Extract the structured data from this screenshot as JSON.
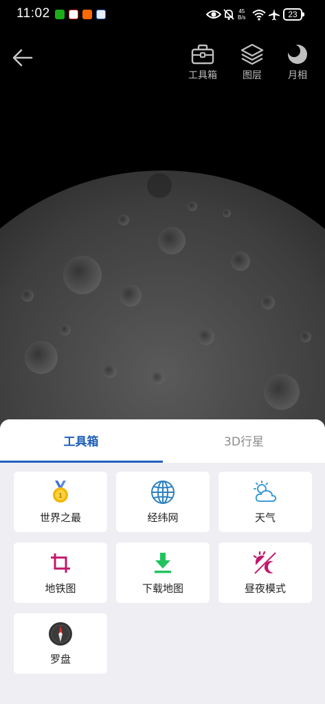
{
  "status_bar": {
    "time": "11:02",
    "net_speed_value": "45",
    "net_speed_unit": "B/s",
    "battery": "23"
  },
  "toolbar": {
    "back_icon": "arrow-left-icon",
    "items": [
      {
        "label": "工具箱",
        "icon": "toolbox-icon"
      },
      {
        "label": "图层",
        "icon": "layers-icon"
      },
      {
        "label": "月相",
        "icon": "moon-phase-icon"
      }
    ]
  },
  "tabs": [
    {
      "label": "工具箱",
      "active": true
    },
    {
      "label": "3D行星",
      "active": false
    }
  ],
  "tools": [
    {
      "label": "世界之最",
      "icon": "medal-icon",
      "color": "#f2b705"
    },
    {
      "label": "经纬网",
      "icon": "globe-grid-icon",
      "color": "#2b7fc0"
    },
    {
      "label": "天气",
      "icon": "weather-sun-cloud-icon",
      "color": "#3a9bd9"
    },
    {
      "label": "地铁图",
      "icon": "crop-metro-icon",
      "color": "#c2186b"
    },
    {
      "label": "下载地图",
      "icon": "download-icon",
      "color": "#22c35e"
    },
    {
      "label": "昼夜模式",
      "icon": "day-night-icon",
      "color": "#c2186b"
    },
    {
      "label": "罗盘",
      "icon": "compass-icon",
      "color": "#333333"
    }
  ],
  "colors": {
    "accent": "#1e5fb8",
    "sheet_bg": "#eeeef3",
    "background": "#000000"
  }
}
